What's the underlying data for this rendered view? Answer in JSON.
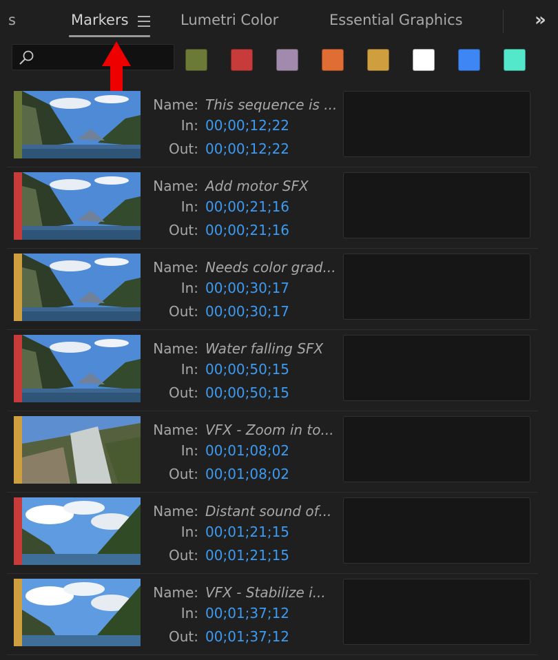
{
  "tabs": {
    "partial_left": "s",
    "markers": "Markers",
    "lumetri": "Lumetri Color",
    "essential": "Essential Graphics",
    "overflow": "»"
  },
  "search": {
    "placeholder": "",
    "value": ""
  },
  "color_filters": [
    {
      "name": "green",
      "hex": "#6c7a37"
    },
    {
      "name": "red",
      "hex": "#c73b3a"
    },
    {
      "name": "violet",
      "hex": "#a28aad"
    },
    {
      "name": "orange",
      "hex": "#e06d33"
    },
    {
      "name": "yellow",
      "hex": "#cf9f3f"
    },
    {
      "name": "white",
      "hex": "#ffffff"
    },
    {
      "name": "blue",
      "hex": "#3d86f4"
    },
    {
      "name": "teal",
      "hex": "#52e8c9"
    }
  ],
  "labels": {
    "name": "Name:",
    "in": "In:",
    "out": "Out:"
  },
  "markers": [
    {
      "color": "#6c7a37",
      "name": "This sequence is ...",
      "in": "00;00;12;22",
      "out": "00;00;12;22",
      "scene": "fjord"
    },
    {
      "color": "#c73b3a",
      "name": "Add motor SFX",
      "in": "00;00;21;16",
      "out": "00;00;21;16",
      "scene": "fjord"
    },
    {
      "color": "#cf9f3f",
      "name": "Needs color grad...",
      "in": "00;00;30;17",
      "out": "00;00;30;17",
      "scene": "fjord"
    },
    {
      "color": "#c73b3a",
      "name": "Water falling SFX",
      "in": "00;00;50;15",
      "out": "00;00;50;15",
      "scene": "fjord"
    },
    {
      "color": "#cf9f3f",
      "name": "VFX - Zoom in to...",
      "in": "00;01;08;02",
      "out": "00;01;08;02",
      "scene": "waterfall"
    },
    {
      "color": "#c73b3a",
      "name": "Distant sound of...",
      "in": "00;01;21;15",
      "out": "00;01;21;15",
      "scene": "cloudy"
    },
    {
      "color": "#cf9f3f",
      "name": "VFX - Stabilize i...",
      "in": "00;01;37;12",
      "out": "00;01;37;12",
      "scene": "cloudy"
    }
  ]
}
